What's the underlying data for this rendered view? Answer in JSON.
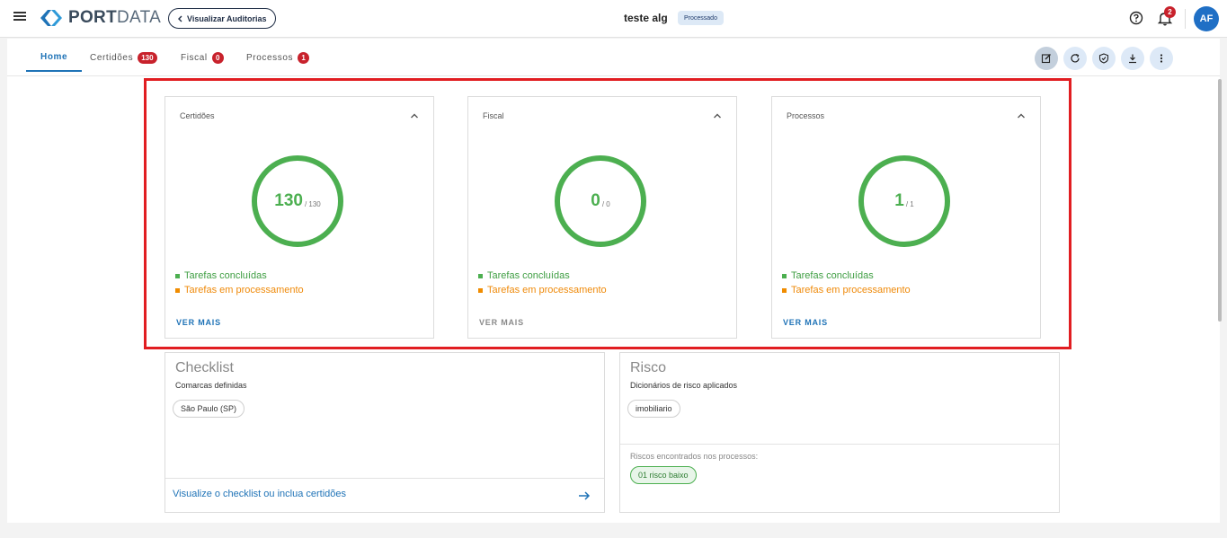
{
  "header": {
    "logo_bold": "PORT",
    "logo_light": "DATA",
    "back_label": "Visualizar Auditorias",
    "title": "teste alg",
    "status": "Processado",
    "notifications_count": "2",
    "avatar_initials": "AF"
  },
  "tabs": [
    {
      "label": "Home",
      "badge": ""
    },
    {
      "label": "Certidões",
      "badge": "130"
    },
    {
      "label": "Fiscal",
      "badge": "0"
    },
    {
      "label": "Processos",
      "badge": "1"
    }
  ],
  "toolbar": {
    "icons": [
      "edit-icon",
      "refresh-icon",
      "shield-check-icon",
      "download-icon",
      "more-vertical-icon"
    ]
  },
  "cards": [
    {
      "title": "Certidões",
      "value": "130",
      "total": "/ 130",
      "done_label": "Tarefas concluídas",
      "proc_label": "Tarefas em processamento",
      "ver_mais": "VER MAIS",
      "ver_mais_enabled": true,
      "progress": 1.0
    },
    {
      "title": "Fiscal",
      "value": "0",
      "total": "/ 0",
      "done_label": "Tarefas concluídas",
      "proc_label": "Tarefas em processamento",
      "ver_mais": "VER MAIS",
      "ver_mais_enabled": false,
      "progress": 1.0
    },
    {
      "title": "Processos",
      "value": "1",
      "total": "/ 1",
      "done_label": "Tarefas concluídas",
      "proc_label": "Tarefas em processamento",
      "ver_mais": "VER MAIS",
      "ver_mais_enabled": true,
      "progress": 1.0
    }
  ],
  "checklist": {
    "title": "Checklist",
    "subtitle": "Comarcas definidas",
    "chip": "São Paulo (SP)",
    "link": "Visualize o checklist ou inclua certidões"
  },
  "risco": {
    "title": "Risco",
    "subtitle": "Dicionários de risco aplicados",
    "chip": "imobiliario",
    "found_label": "Riscos encontrados nos processos:",
    "found_chip": "01 risco baixo"
  },
  "colors": {
    "primary": "#1f73b7",
    "success": "#4caf50",
    "warning": "#f08c00",
    "danger": "#c8222c",
    "highlight": "#e11d21"
  }
}
